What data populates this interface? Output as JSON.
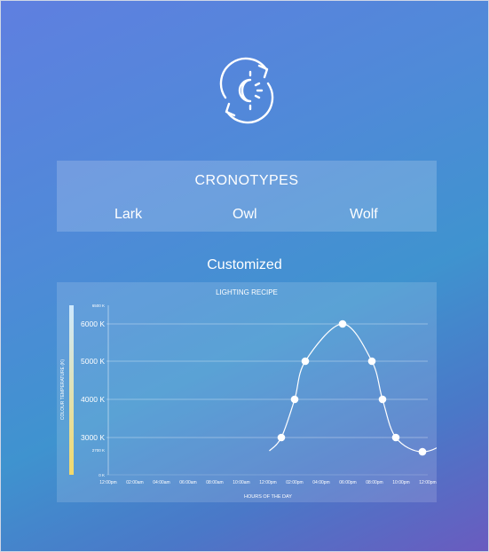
{
  "cronotypes": {
    "title": "CRONOTYPES",
    "items": [
      "Lark",
      "Owl",
      "Wolf"
    ]
  },
  "customized_label": "Customized",
  "chart_data": {
    "type": "line",
    "title": "LIGHTING RECIPE",
    "xlabel": "HOURS OF THE DAY",
    "ylabel": "COLOUR TEMPERATURE (K)",
    "x_ticks": [
      "12:00pm",
      "02:00am",
      "04:00am",
      "06:00am",
      "08:00am",
      "10:00am",
      "12:00pm",
      "02:00pm",
      "04:00pm",
      "06:00pm",
      "08:00pm",
      "10:00pm",
      "12:00pm"
    ],
    "y_ticks": [
      "0 K",
      "2700 K",
      "3000 K",
      "4000 K",
      "5000 K",
      "6000 K",
      "6500 K"
    ],
    "ylim": [
      0,
      6500
    ],
    "grid": true,
    "series": [
      {
        "points": [
          {
            "x": 6.5,
            "y": 3000
          },
          {
            "x": 7.0,
            "y": 4000
          },
          {
            "x": 7.4,
            "y": 5000
          },
          {
            "x": 8.8,
            "y": 6000
          },
          {
            "x": 9.9,
            "y": 5000
          },
          {
            "x": 10.3,
            "y": 4000
          },
          {
            "x": 10.8,
            "y": 3000
          },
          {
            "x": 11.8,
            "y": 2500
          },
          {
            "x": 12.8,
            "y": 3000
          },
          {
            "x": 13.3,
            "y": 4000
          },
          {
            "x": 13.7,
            "y": 5000
          },
          {
            "x": 15.2,
            "y": 6000
          },
          {
            "x": 16.3,
            "y": 5000
          },
          {
            "x": 16.7,
            "y": 4000
          },
          {
            "x": 17.1,
            "y": 3000
          }
        ]
      }
    ],
    "colorbar": {
      "top": "#cde9ff",
      "bottom": "#f3d96a"
    }
  }
}
